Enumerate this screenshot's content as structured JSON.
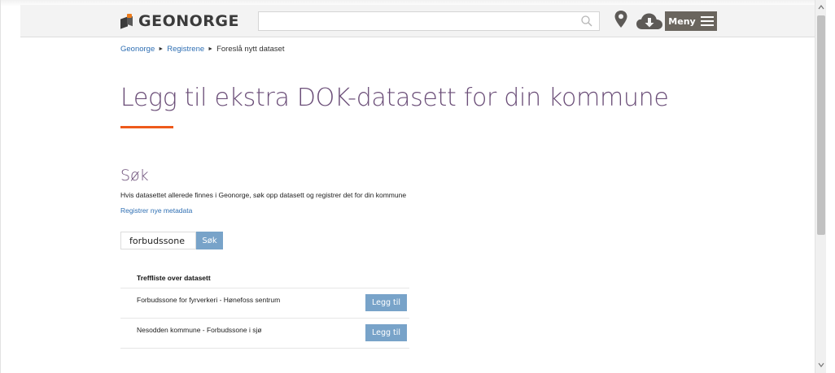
{
  "header": {
    "logo_text": "GEONORGE",
    "search_placeholder": "",
    "menu_label": "Meny",
    "icons": [
      "search-icon",
      "location-pin-icon",
      "cloud-download-icon",
      "hamburger-icon"
    ]
  },
  "breadcrumb": {
    "items": [
      "Geonorge",
      "Registrene",
      "Foreslå nytt dataset"
    ],
    "separator": "►"
  },
  "page": {
    "title": "Legg til ekstra DOK-datasett for din kommune"
  },
  "search_section": {
    "heading": "Søk",
    "description": "Hvis datasettet allerede finnes i Geonorge, søk opp datasett og registrer det for din kommune",
    "register_link": "Registrer nye metadata",
    "query_value": "forbudssone",
    "button_label": "Søk"
  },
  "results": {
    "header": "Treffliste over datasett",
    "rows": [
      {
        "name": "Forbudssone for fyrverkeri - Hønefoss sentrum",
        "button": "Legg til"
      },
      {
        "name": "Nesodden kommune - Forbudssone i sjø",
        "button": "Legg til"
      }
    ]
  },
  "colors": {
    "title": "#6b4e78",
    "accent_underline": "#ee5a1b",
    "link": "#2f6fb3",
    "button": "#78a3c9",
    "menu_button": "#6a655e",
    "logo_accent": "#ee7c1b"
  }
}
